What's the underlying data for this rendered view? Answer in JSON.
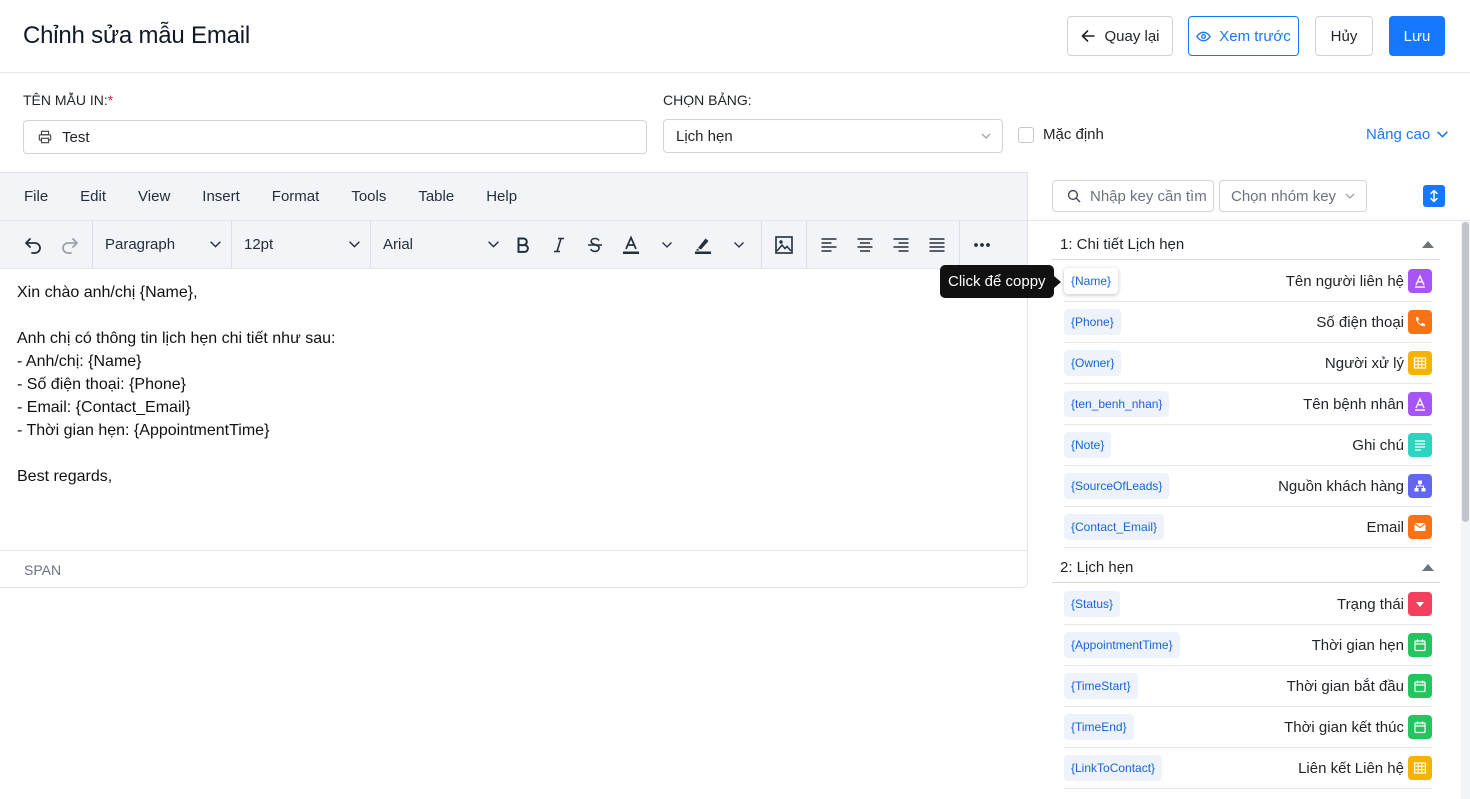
{
  "header": {
    "title": "Chỉnh sửa mẫu Email",
    "back_label": "Quay lại",
    "preview_label": "Xem trước",
    "cancel_label": "Hủy",
    "save_label": "Lưu"
  },
  "form": {
    "template_name_label": "TÊN MẪU IN:",
    "required_mark": "*",
    "template_name_value": "Test",
    "table_label": "CHỌN BẢNG:",
    "table_value": "Lịch hẹn",
    "default_label": "Mặc định",
    "default_checked": false,
    "advanced_label": "Nâng cao"
  },
  "editor": {
    "menu": [
      "File",
      "Edit",
      "View",
      "Insert",
      "Format",
      "Tools",
      "Table",
      "Help"
    ],
    "block_format": "Paragraph",
    "font_size": "12pt",
    "font_family": "Arial",
    "content": [
      "Xin chào anh/chị {Name},",
      "",
      "Anh chị có thông tin lịch hẹn chi tiết như sau:",
      "- Anh/chị: {Name}",
      "- Số điện thoại: {Phone}",
      "- Email: {Contact_Email}",
      "- Thời gian hẹn: {AppointmentTime}",
      "",
      "Best regards,"
    ],
    "status_path": "SPAN"
  },
  "tooltip": "Click để coppy",
  "keys_panel": {
    "search_placeholder": "Nhập key cần tìm",
    "group_placeholder": "Chọn nhóm key",
    "sections": [
      {
        "title": "1: Chi tiết Lịch hẹn",
        "items": [
          {
            "key": "{Name}",
            "label": "Tên người liên hệ",
            "icon": "text-icon",
            "color": "#a855f7"
          },
          {
            "key": "{Phone}",
            "label": "Số điện thoại",
            "icon": "phone-icon",
            "color": "#f97316"
          },
          {
            "key": "{Owner}",
            "label": "Người xử lý",
            "icon": "grid-icon",
            "color": "#f5b300"
          },
          {
            "key": "{ten_benh_nhan}",
            "label": "Tên bệnh nhân",
            "icon": "text-icon",
            "color": "#a855f7"
          },
          {
            "key": "{Note}",
            "label": "Ghi chú",
            "icon": "paragraph-icon",
            "color": "#2dd4bf"
          },
          {
            "key": "{SourceOfLeads}",
            "label": "Nguồn khách hàng",
            "icon": "hierarchy-icon",
            "color": "#6366f1"
          },
          {
            "key": "{Contact_Email}",
            "label": "Email",
            "icon": "mail-icon",
            "color": "#f97316"
          }
        ]
      },
      {
        "title": "2: Lịch hẹn",
        "items": [
          {
            "key": "{Status}",
            "label": "Trạng thái",
            "icon": "dropdown-icon",
            "color": "#f43f5e"
          },
          {
            "key": "{AppointmentTime}",
            "label": "Thời gian hẹn",
            "icon": "calendar-icon",
            "color": "#22c55e"
          },
          {
            "key": "{TimeStart}",
            "label": "Thời gian bắt đầu",
            "icon": "calendar-icon",
            "color": "#22c55e"
          },
          {
            "key": "{TimeEnd}",
            "label": "Thời gian kết thúc",
            "icon": "calendar-icon",
            "color": "#22c55e"
          },
          {
            "key": "{LinkToContact}",
            "label": "Liên kết Liên hệ",
            "icon": "grid-icon",
            "color": "#f5b300"
          }
        ]
      }
    ]
  },
  "colors": {
    "primary": "#1677ff",
    "required": "#e11d48"
  }
}
